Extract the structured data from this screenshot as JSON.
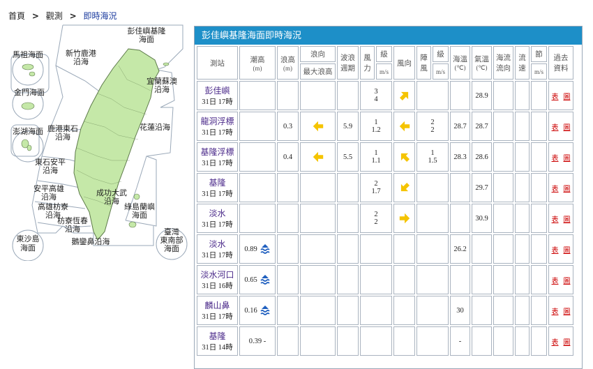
{
  "breadcrumb": {
    "home": "首頁",
    "observe": "觀測",
    "current": "即時海況"
  },
  "map": {
    "labels": {
      "pengjia": [
        "彭佳嶼基隆",
        "海面"
      ],
      "matsu": "馬祖海面",
      "xinzhu": [
        "新竹鹿港",
        "沿海"
      ],
      "yilan": [
        "宜蘭蘇澳",
        "沿海"
      ],
      "kinmen": "金門海面",
      "penghu": "澎湖海面",
      "lugang": [
        "鹿港東石",
        "沿海"
      ],
      "hualien": "花蓮沿海",
      "dongshi": [
        "東石安平",
        "沿海"
      ],
      "anping": [
        "安平高雄",
        "沿海"
      ],
      "chenggong": [
        "成功大武",
        "沿海"
      ],
      "kaohsiung": [
        "高雄枋寮",
        "沿海"
      ],
      "ludao": [
        "綠島蘭嶼",
        "海面"
      ],
      "fangliao": [
        "枋寮恆春",
        "沿海"
      ],
      "dongsha": [
        "東沙島",
        "海面"
      ],
      "eluanbi": "鵝鑾鼻沿海",
      "southeast": [
        "臺灣",
        "東南部",
        "海面"
      ]
    }
  },
  "panel_title": "彭佳嶼基隆海面即時海況",
  "headers": {
    "station": "測站",
    "tide": "潮高",
    "tide_unit": "(m)",
    "wave": "浪高",
    "wave_unit": "(m)",
    "wave_dir": "浪向",
    "max_wave": "最大浪高",
    "period": [
      "波浪",
      "週期"
    ],
    "wind_force": [
      "風",
      "力"
    ],
    "wind_level": "級",
    "wind_level_unit": "m/s",
    "wind_dir": "風向",
    "gust": [
      "陣",
      "風"
    ],
    "gust_level": "級",
    "gust_unit": "m/s",
    "sst": "海溫",
    "sst_unit": "(℃)",
    "air_temp": "氣溫",
    "air_unit": "(℃)",
    "current_dir": [
      "海流",
      "流向"
    ],
    "current_speed": [
      "流",
      "速"
    ],
    "knot": "節",
    "knot_unit": "m/s",
    "history": [
      "過去",
      "資料"
    ]
  },
  "links": {
    "table": "表",
    "chart": "圖"
  },
  "rows": [
    {
      "station": "彭佳嶼",
      "time": "31日 17時",
      "tide": "",
      "tide_icon": false,
      "wave": "",
      "wave_dir": "",
      "period": "",
      "wind": [
        "3",
        "4"
      ],
      "wind_dir": "ne",
      "gust": [
        "",
        ""
      ],
      "sst": "",
      "air": "28.9"
    },
    {
      "station": "龍洞浮標",
      "time": "31日 17時",
      "tide": "",
      "tide_icon": false,
      "wave": "0.3",
      "wave_dir": "w",
      "period": "5.9",
      "wind": [
        "1",
        "1.2"
      ],
      "wind_dir": "w",
      "gust": [
        "2",
        "2"
      ],
      "sst": "28.7",
      "air": "28.7"
    },
    {
      "station": "基隆浮標",
      "time": "31日 17時",
      "tide": "",
      "tide_icon": false,
      "wave": "0.4",
      "wave_dir": "w",
      "period": "5.5",
      "wind": [
        "1",
        "1.1"
      ],
      "wind_dir": "nw",
      "gust": [
        "1",
        "1.5"
      ],
      "sst": "28.3",
      "air": "28.6"
    },
    {
      "station": "基隆",
      "time": "31日 17時",
      "tide": "",
      "tide_icon": false,
      "wave": "",
      "wave_dir": "",
      "period": "",
      "wind": [
        "2",
        "1.7"
      ],
      "wind_dir": "sw",
      "gust": [
        "",
        ""
      ],
      "sst": "",
      "air": "29.7"
    },
    {
      "station": "淡水",
      "time": "31日 17時",
      "tide": "",
      "tide_icon": false,
      "wave": "",
      "wave_dir": "",
      "period": "",
      "wind": [
        "2",
        "2"
      ],
      "wind_dir": "e",
      "gust": [
        "",
        ""
      ],
      "sst": "",
      "air": "30.9"
    },
    {
      "station": "淡水",
      "time": "31日 17時",
      "tide": "0.89",
      "tide_icon": true,
      "wave": "",
      "wave_dir": "",
      "period": "",
      "wind": [
        "",
        ""
      ],
      "wind_dir": "",
      "gust": [
        "",
        ""
      ],
      "sst": "26.2",
      "air": ""
    },
    {
      "station": "淡水河口",
      "time": "31日 16時",
      "tide": "0.65",
      "tide_icon": true,
      "wave": "",
      "wave_dir": "",
      "period": "",
      "wind": [
        "",
        ""
      ],
      "wind_dir": "",
      "gust": [
        "",
        ""
      ],
      "sst": "",
      "air": ""
    },
    {
      "station": "麟山鼻",
      "time": "31日 17時",
      "tide": "0.16",
      "tide_icon": true,
      "wave": "",
      "wave_dir": "",
      "period": "",
      "wind": [
        "",
        ""
      ],
      "wind_dir": "",
      "gust": [
        "",
        ""
      ],
      "sst": "30",
      "air": ""
    },
    {
      "station": "基隆",
      "time": "31日 14時",
      "tide": "0.39 -",
      "tide_icon": false,
      "wave": "",
      "wave_dir": "",
      "period": "",
      "wind": [
        "",
        ""
      ],
      "wind_dir": "",
      "gust": [
        "",
        ""
      ],
      "sst": "-",
      "air": ""
    }
  ],
  "colors": {
    "title_bar": "#1d8fc8",
    "arrow": "#f5c400",
    "tide_icon": "#1f5fbf",
    "land": "#c5e8a8",
    "link": "#cc0000"
  }
}
